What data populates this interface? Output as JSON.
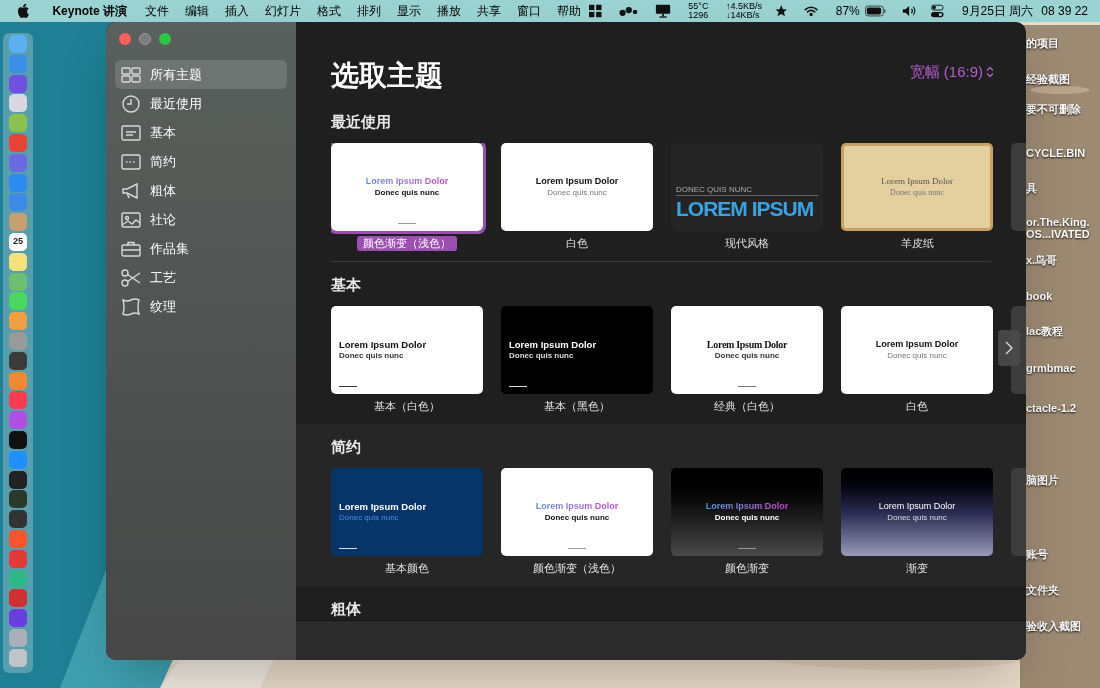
{
  "menubar": {
    "app": "Keynote 讲演",
    "items": [
      "文件",
      "编辑",
      "插入",
      "幻灯片",
      "格式",
      "排列",
      "显示",
      "播放",
      "共享",
      "窗口",
      "帮助"
    ],
    "status": {
      "temp": "55°C",
      "fan": "1296",
      "up": "↑4.5KB/s",
      "down": "↓14KB/s",
      "battery": "87%",
      "date": "9月25日 周六",
      "time": "08 39 22"
    }
  },
  "dock": {
    "apps": [
      {
        "color": "#5ab0f0"
      },
      {
        "color": "#3b8fe6"
      },
      {
        "color": "#7050e0"
      },
      {
        "color": "#d8d8e0"
      },
      {
        "color": "#8bc34a"
      },
      {
        "color": "#ea4335"
      },
      {
        "color": "#6a6ae0"
      },
      {
        "color": "#2a8cf0"
      },
      {
        "color": "#3c8ce6"
      },
      {
        "color": "#c8a070"
      },
      {
        "color": "#ffffff",
        "text": "25"
      },
      {
        "color": "#f7e27a"
      },
      {
        "color": "#6cc070"
      },
      {
        "color": "#48d860"
      },
      {
        "color": "#f0a040"
      },
      {
        "color": "#9a9a9a"
      },
      {
        "color": "#3a3a3a"
      },
      {
        "color": "#f08a30"
      },
      {
        "color": "#fa3c50"
      },
      {
        "color": "#b050e0"
      },
      {
        "color": "#111111"
      },
      {
        "color": "#1e90ff"
      },
      {
        "color": "#222222"
      },
      {
        "color": "#2a3a2a"
      },
      {
        "color": "#333333"
      },
      {
        "color": "#fb542b"
      },
      {
        "color": "#e53935"
      },
      {
        "color": "#2eb88a"
      },
      {
        "color": "#d32f2f"
      },
      {
        "color": "#6a3de0"
      },
      {
        "color": "#aab0b8"
      },
      {
        "color": "#c0c4c8"
      }
    ]
  },
  "desktop_labels": [
    "的项目",
    "经验截图",
    "要不可删除",
    "CYCLE.BIN",
    "具",
    "or.The.King.",
    "OS...IVATED",
    "x.鸟哥",
    "book",
    "lac教程",
    "grmbmac",
    "ctacle-1.2",
    "脑图片",
    "账号",
    "文件夹",
    "验收入截图"
  ],
  "sidebar": {
    "items": [
      {
        "label": "所有主题",
        "selected": true
      },
      {
        "label": "最近使用",
        "selected": false
      },
      {
        "label": "基本",
        "selected": false
      },
      {
        "label": "简约",
        "selected": false
      },
      {
        "label": "粗体",
        "selected": false
      },
      {
        "label": "社论",
        "selected": false
      },
      {
        "label": "作品集",
        "selected": false
      },
      {
        "label": "工艺",
        "selected": false
      },
      {
        "label": "纹理",
        "selected": false
      }
    ]
  },
  "header": {
    "title": "选取主题",
    "aspect": "宽幅 (16:9)"
  },
  "sections": [
    {
      "title": "最近使用",
      "themes": [
        {
          "kind": "gradient-light",
          "label": "颜色渐变（浅色）",
          "title": "Lorem Ipsum Dolor",
          "subtitle": "Donec quis nunc",
          "selected": true
        },
        {
          "kind": "white",
          "label": "白色",
          "title": "Lorem Ipsum Dolor",
          "subtitle": "Donec quis nunc",
          "selected": false
        },
        {
          "kind": "modern",
          "label": "现代风格",
          "title": "LOREM IPSUM",
          "subtitle": "DONEC QUIS NUNC",
          "selected": false
        },
        {
          "kind": "parchment",
          "label": "羊皮纸",
          "title": "Lorem Ipsum Dolor",
          "subtitle": "Donec quis nunc",
          "selected": false
        },
        {
          "kind": "cut"
        }
      ]
    },
    {
      "title": "基本",
      "has_next": true,
      "themes": [
        {
          "kind": "basic-white",
          "label": "基本（白色）",
          "title": "Lorem Ipsum Dolor",
          "subtitle": "Donec quis nunc",
          "selected": false
        },
        {
          "kind": "basic-black",
          "label": "基本（黑色）",
          "title": "Lorem Ipsum Dolor",
          "subtitle": "Donec quis nunc",
          "selected": false
        },
        {
          "kind": "classic-white",
          "label": "经典（白色）",
          "title": "Lorem Ipsum Dolor",
          "subtitle": "Donec quis nunc",
          "selected": false
        },
        {
          "kind": "white",
          "label": "白色",
          "title": "Lorem Ipsum Dolor",
          "subtitle": "Donec quis nunc",
          "selected": false
        },
        {
          "kind": "cut"
        }
      ]
    },
    {
      "title": "简约",
      "themes": [
        {
          "kind": "basic-color",
          "label": "基本颜色",
          "title": "Lorem Ipsum Dolor",
          "subtitle": "Donec quis nunc",
          "selected": false
        },
        {
          "kind": "gradient-light",
          "label": "颜色渐变（浅色）",
          "title": "Lorem Ipsum Dolor",
          "subtitle": "Donec quis nunc",
          "selected": false
        },
        {
          "kind": "gradient-dark",
          "label": "颜色渐变",
          "title": "Lorem Ipsum Dolor",
          "subtitle": "Donec quis nunc",
          "selected": false
        },
        {
          "kind": "gradient",
          "label": "渐变",
          "title": "Lorem Ipsum Dolor",
          "subtitle": "Donec quis nunc",
          "selected": false
        },
        {
          "kind": "cut"
        }
      ]
    },
    {
      "title": "粗体"
    }
  ]
}
